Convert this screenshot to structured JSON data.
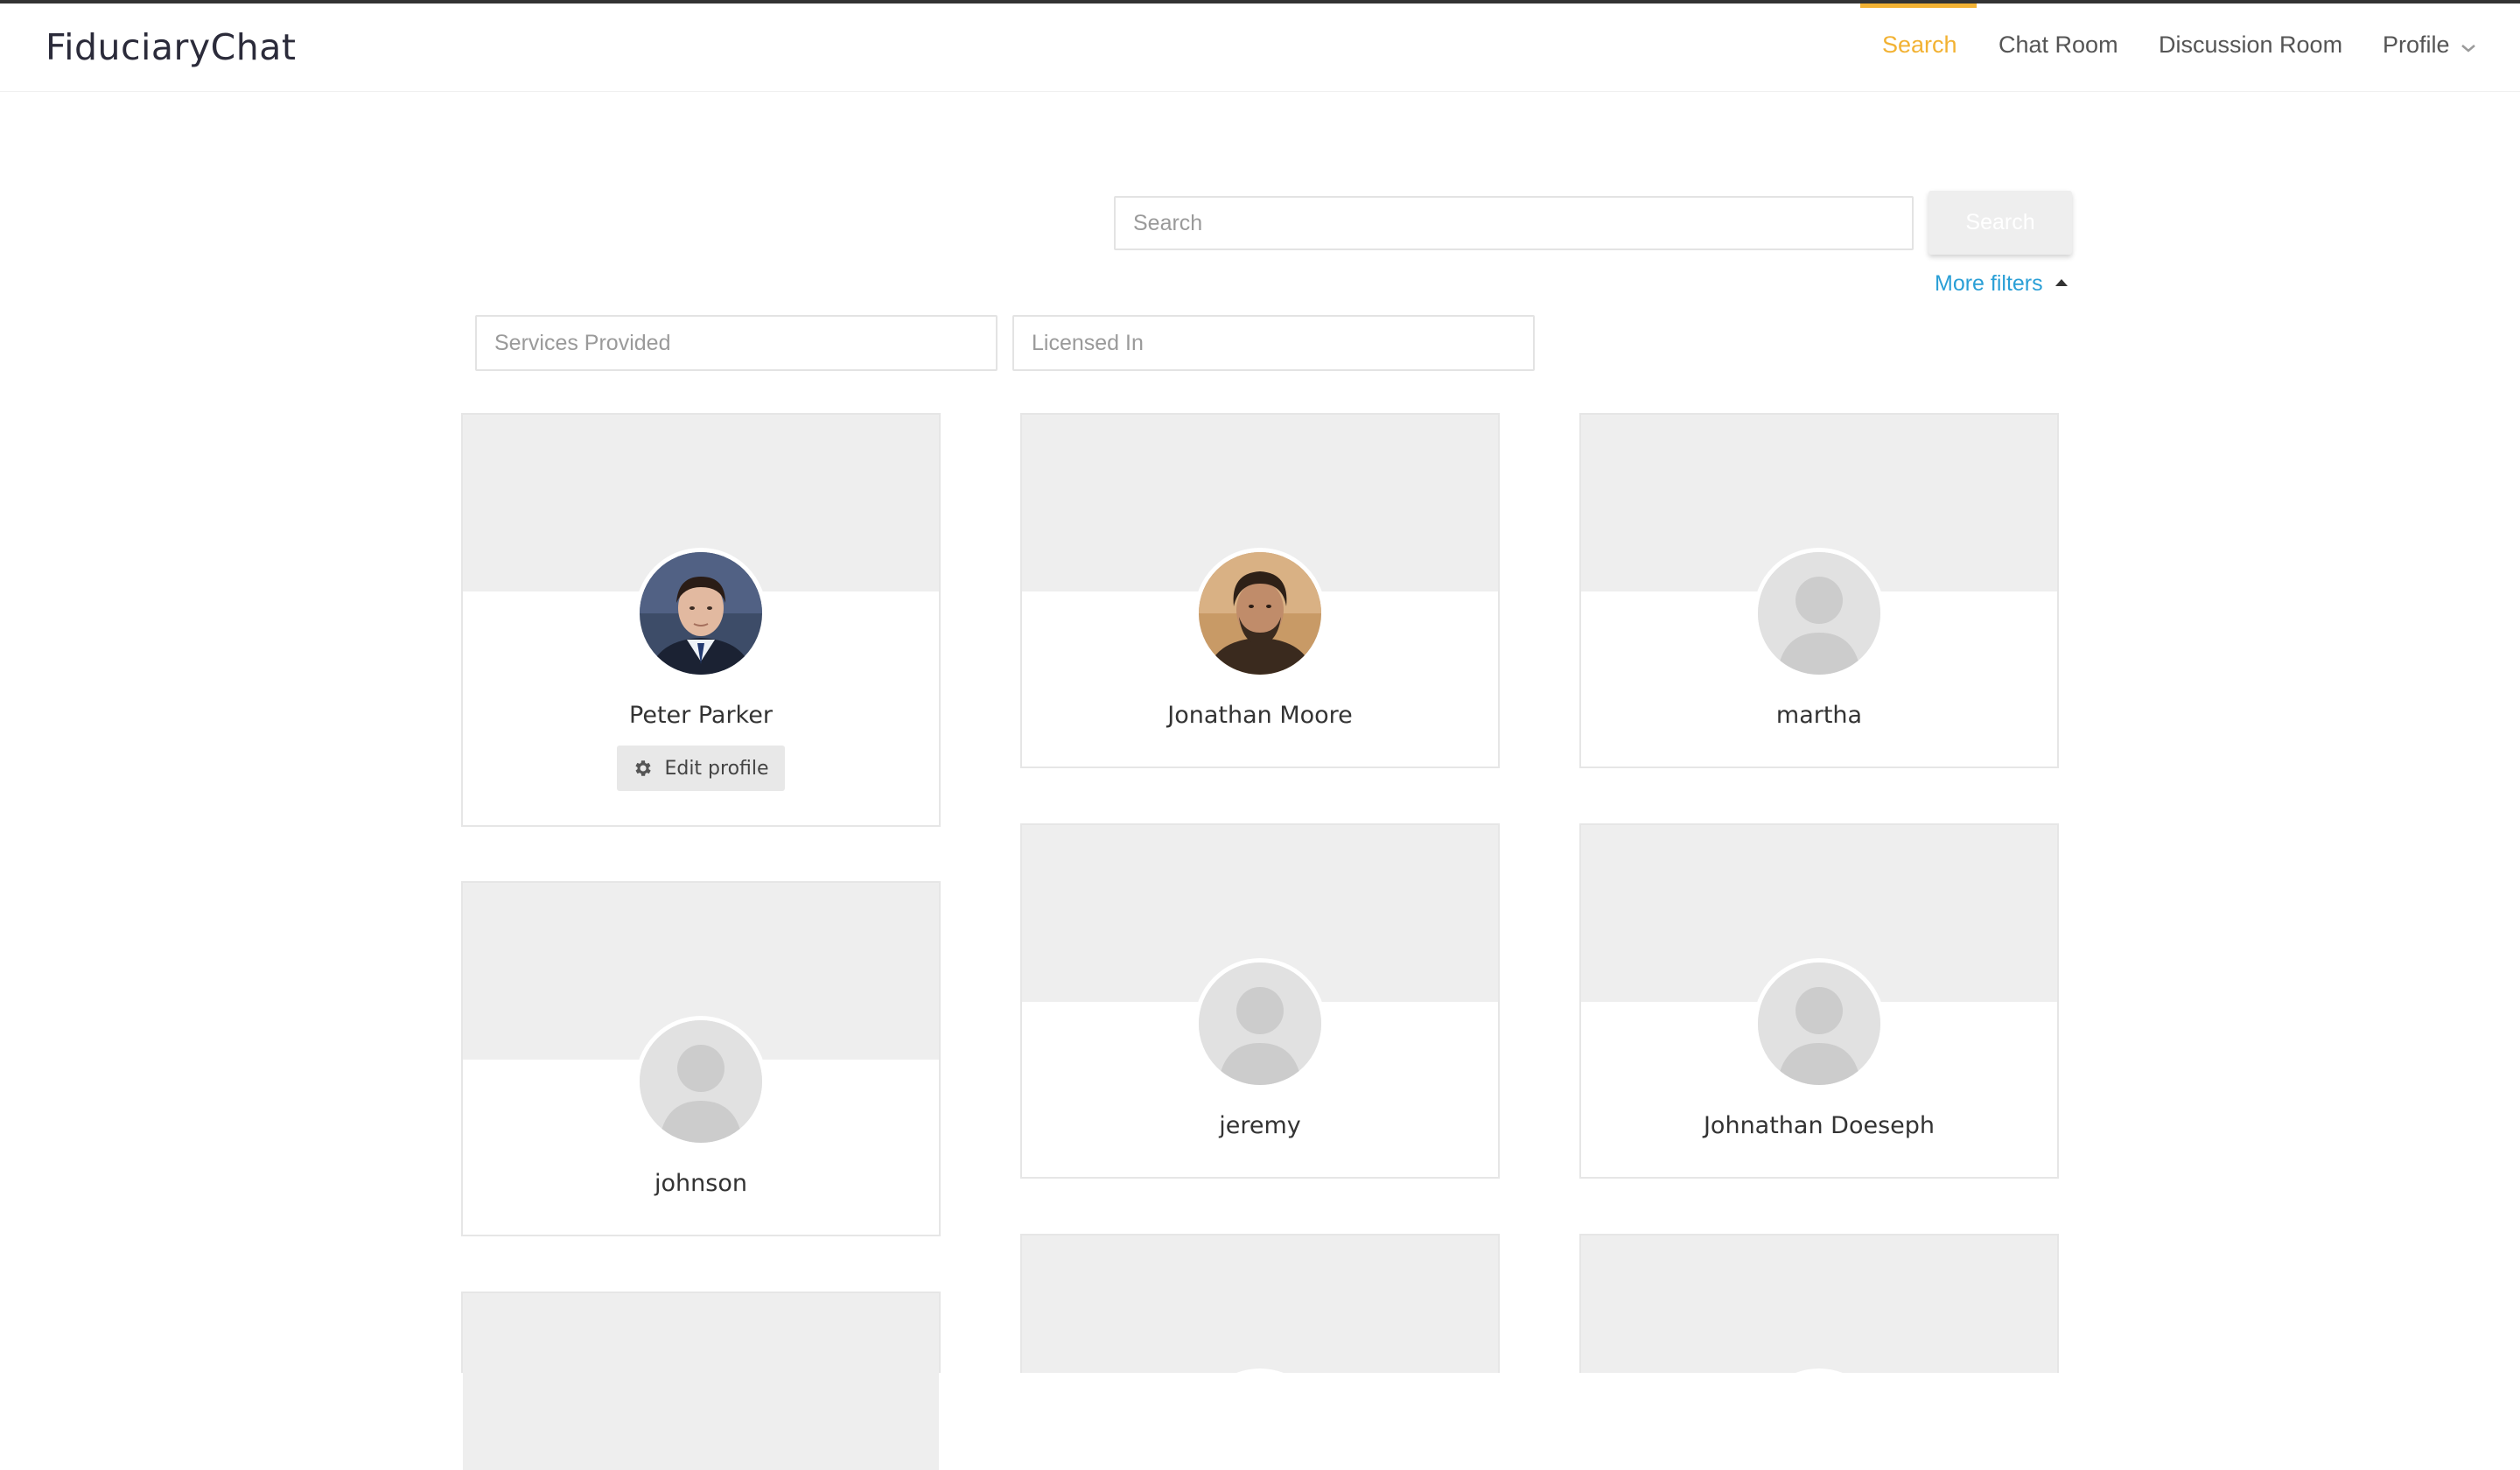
{
  "app": {
    "brand": "FiduciaryChat"
  },
  "nav": {
    "items": [
      {
        "label": "Search",
        "active": true
      },
      {
        "label": "Chat Room",
        "active": false
      },
      {
        "label": "Discussion Room",
        "active": false
      },
      {
        "label": "Profile",
        "active": false,
        "has_dropdown": true
      }
    ],
    "accent_color": "#f2b233"
  },
  "search": {
    "placeholder": "Search",
    "value": "",
    "button_label": "Search"
  },
  "filters": {
    "toggle_label": "More filters",
    "services_placeholder": "Services Provided",
    "licensed_placeholder": "Licensed In",
    "link_color": "#2a9fd6"
  },
  "cards": [
    {
      "name": "Peter Parker",
      "avatar": "photo-peter",
      "edit_label": "Edit profile"
    },
    {
      "name": "Jonathan Moore",
      "avatar": "photo-jonathan"
    },
    {
      "name": "martha",
      "avatar": "default-avatar-icon"
    },
    {
      "name": "johnson",
      "avatar": "default-avatar-icon"
    },
    {
      "name": "jeremy",
      "avatar": "default-avatar-icon"
    },
    {
      "name": "Johnathan Doeseph",
      "avatar": "default-avatar-icon"
    },
    {
      "name": "",
      "avatar": "unknown"
    },
    {
      "name": "",
      "avatar": "teal-avatar"
    },
    {
      "name": "",
      "avatar": "unknown"
    }
  ]
}
